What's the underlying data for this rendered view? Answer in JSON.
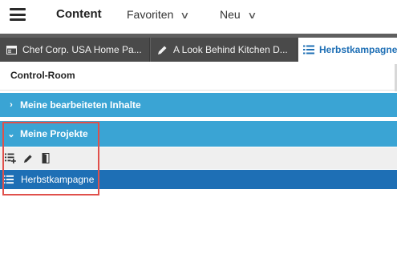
{
  "header": {
    "title": "Content",
    "menus": [
      {
        "label": "Favoriten"
      },
      {
        "label": "Neu"
      }
    ]
  },
  "tabs": [
    {
      "label": "Chef Corp. USA Home Pa...",
      "icon": "page-icon"
    },
    {
      "label": "A Look Behind Kitchen D...",
      "icon": "pencil-icon"
    },
    {
      "label": "Herbstkampagne",
      "icon": "list-icon",
      "active": true
    }
  ],
  "control_room": {
    "title": "Control-Room",
    "sections": [
      {
        "label": "Meine bearbeiteten Inhalte",
        "expanded": false
      },
      {
        "label": "Meine Projekte",
        "expanded": true
      }
    ],
    "project_toolbar": [
      "add-list-icon",
      "pencil-icon",
      "door-icon"
    ],
    "projects": [
      {
        "label": "Herbstkampagne",
        "selected": true
      }
    ]
  },
  "colors": {
    "section_bg": "#3aa4d4",
    "selected_bg": "#1e6fb5",
    "tab_strip_bg": "#5f5f5f",
    "highlight_border": "#e0504b"
  }
}
